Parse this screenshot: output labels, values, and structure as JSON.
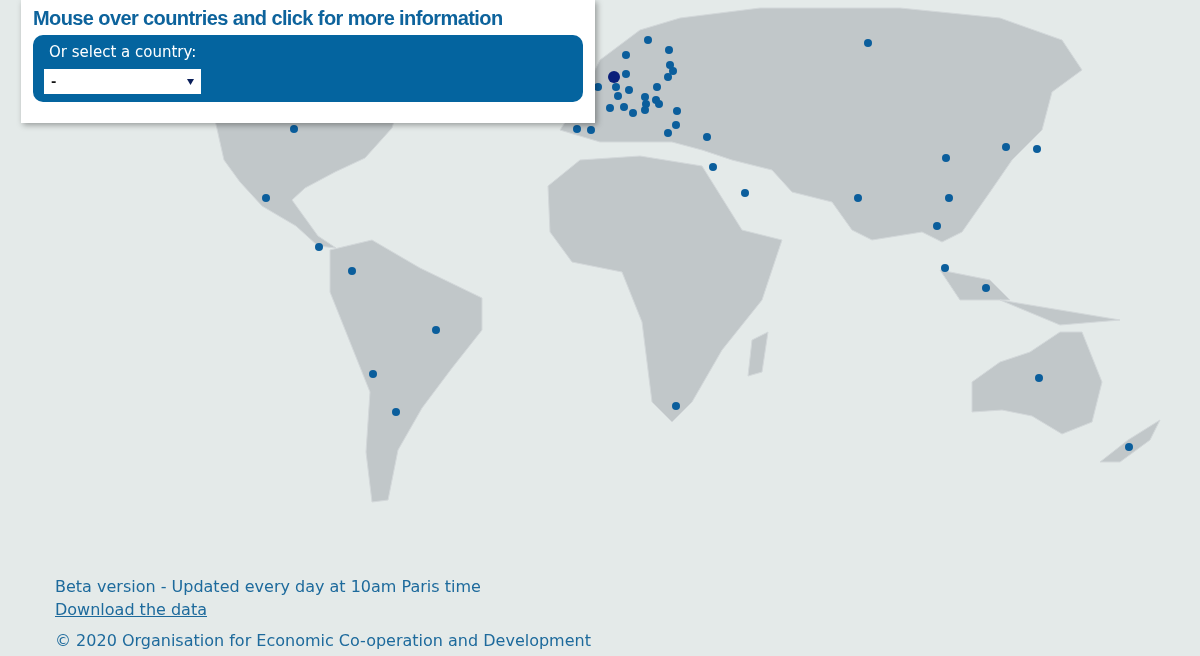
{
  "panel": {
    "title": "Mouse over countries and click for more information",
    "select_label": "Or select a country:",
    "select_value": "-"
  },
  "footer": {
    "note": "Beta version - Updated every day at 10am Paris time",
    "link": "Download the data",
    "copyright": "© 2020 Organisation for Economic Co-operation and Development"
  }
}
